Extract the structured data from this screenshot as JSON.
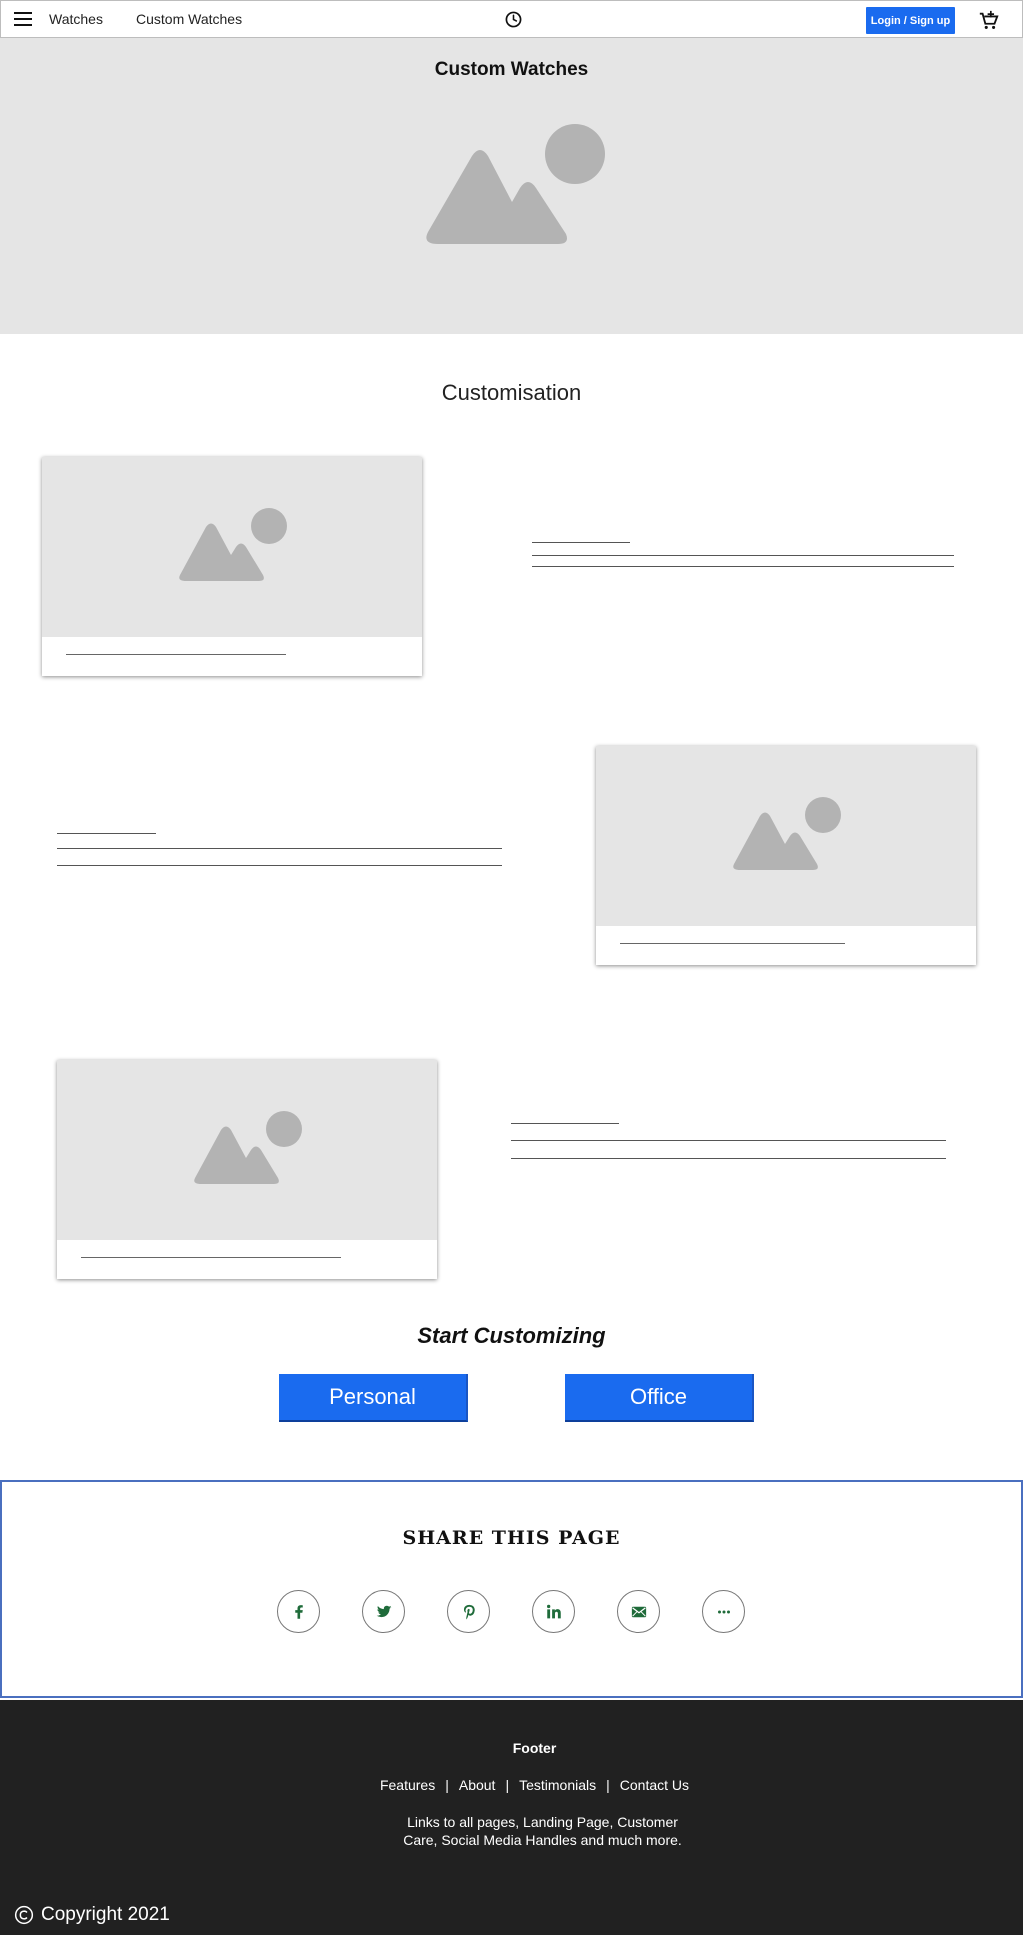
{
  "nav": {
    "links": [
      "Watches",
      "Custom Watches"
    ],
    "login_label": "Login / Sign up",
    "accent": "#1a6bef"
  },
  "hero": {
    "title": "Custom Watches",
    "image_icon": "image-placeholder-icon"
  },
  "section": {
    "title": "Customisation"
  },
  "cta": {
    "title": "Start Customizing",
    "buttons": [
      "Personal",
      "Office"
    ]
  },
  "share": {
    "title": "SHARE THIS PAGE",
    "icons": [
      "facebook-icon",
      "twitter-icon",
      "pinterest-icon",
      "linkedin-icon",
      "email-icon",
      "more-icon"
    ]
  },
  "footer": {
    "title": "Footer",
    "links": [
      "Features",
      "About",
      "Testimonials",
      "Contact Us"
    ],
    "separator": "|",
    "description": "Links to all pages, Landing Page, Customer Care, Social Media Handles and much more.",
    "copyright": "Copyright 2021"
  }
}
